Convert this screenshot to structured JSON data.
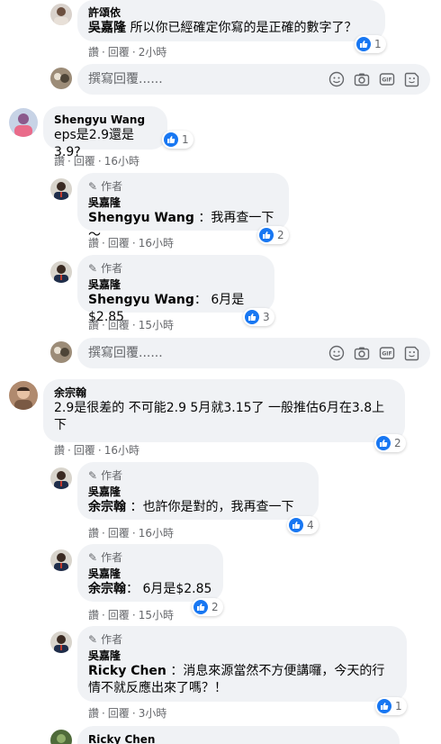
{
  "colors": {
    "like": "#1877f2",
    "bubble": "#f0f2f5",
    "meta": "#65676b"
  },
  "reply_placeholder": "撰寫回覆......",
  "comments": [
    {
      "name": "許頌依",
      "mention": "吳嘉隆",
      "text": " 所以你已經確定你寫的是正確的數字了？",
      "likes": "1",
      "actions": {
        "like": "讚",
        "reply": "回覆",
        "time": "2小時"
      }
    },
    {
      "name": "Shengyu Wang",
      "text": "eps是2.9還是3.9?",
      "likes": "1",
      "actions": {
        "like": "讚",
        "reply": "回覆",
        "time": "16小時"
      }
    },
    {
      "author_tag": "作者",
      "name": "吳嘉隆",
      "mention": "Shengyu Wang",
      "text": " ：我再查一下～",
      "likes": "2",
      "actions": {
        "like": "讚",
        "reply": "回覆",
        "time": "16小時"
      }
    },
    {
      "author_tag": "作者",
      "name": "吳嘉隆",
      "mention": "Shengyu Wang",
      "text": "： 6月是$2.85",
      "likes": "3",
      "actions": {
        "like": "讚",
        "reply": "回覆",
        "time": "15小時"
      }
    },
    {
      "name": "余宗翰",
      "text": "2.9是很差的 不可能2.9 5月就3.15了 一般推估6月在3.8上下",
      "likes": "2",
      "actions": {
        "like": "讚",
        "reply": "回覆",
        "time": "16小時"
      }
    },
    {
      "author_tag": "作者",
      "name": "吳嘉隆",
      "mention": "余宗翰",
      "text": " ：也許你是對的，我再查一下",
      "likes": "4",
      "actions": {
        "like": "讚",
        "reply": "回覆",
        "time": "16小時"
      }
    },
    {
      "author_tag": "作者",
      "name": "吳嘉隆",
      "mention": "余宗翰",
      "text": "： 6月是$2.85",
      "likes": "2",
      "actions": {
        "like": "讚",
        "reply": "回覆",
        "time": "15小時"
      }
    },
    {
      "author_tag": "作者",
      "name": "吳嘉隆",
      "mention": "Ricky Chen",
      "text": " ：消息來源當然不方便講囉，今天的行情不就反應出來了嗎？！",
      "likes": "1",
      "actions": {
        "like": "讚",
        "reply": "回覆",
        "time": "3小時"
      }
    },
    {
      "name": "Ricky Chen"
    }
  ]
}
